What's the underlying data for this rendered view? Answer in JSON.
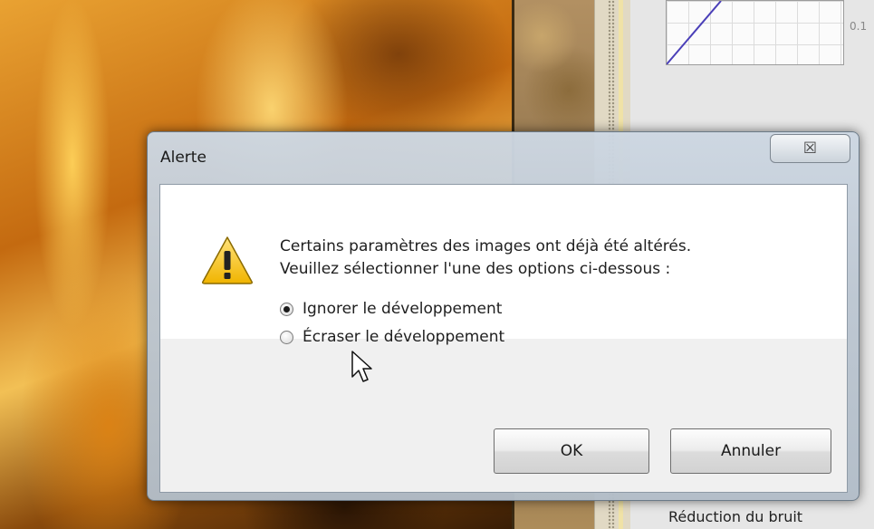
{
  "background": {
    "graph_tick_label": "0.1",
    "panel_label": "Réduction du bruit"
  },
  "dialog": {
    "title": "Alerte",
    "close_glyph": "☒",
    "icon": "warning-icon",
    "message_line1": "Certains paramètres des images ont déjà été altérés.",
    "message_line2": "Veuillez sélectionner l'une des options ci-dessous :",
    "options": [
      {
        "label": "Ignorer le développement",
        "selected": true
      },
      {
        "label": "Écraser le développement",
        "selected": false
      }
    ],
    "ok_label": "OK",
    "cancel_label": "Annuler"
  }
}
